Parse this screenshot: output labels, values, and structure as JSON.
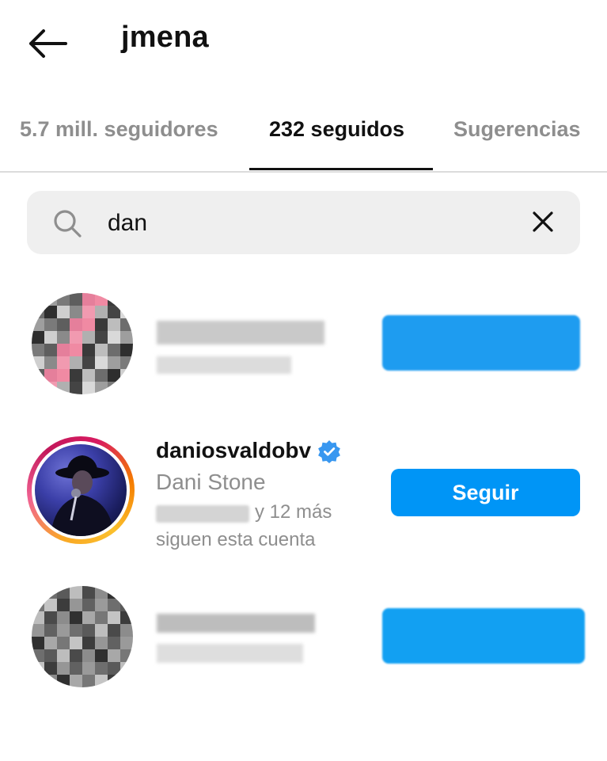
{
  "header": {
    "title": "jmena",
    "back_icon": "arrow-left-icon"
  },
  "tabs": [
    {
      "label": "5.7 mill. seguidores",
      "active": false
    },
    {
      "label": "232 seguidos",
      "active": true
    },
    {
      "label": "Sugerencias",
      "active": false
    }
  ],
  "search": {
    "value": "dan",
    "search_icon": "search-icon",
    "clear_icon": "close-icon"
  },
  "list": [
    {
      "username": "",
      "redacted": true
    },
    {
      "username": "daniosvaldobv",
      "verified": true,
      "full_name": "Dani Stone",
      "mutual_suffix": "y 12 más",
      "mutual_line2": "siguen esta cuenta",
      "action_label": "Seguir",
      "redacted": false
    },
    {
      "username": "",
      "redacted": true
    }
  ],
  "colors": {
    "accent": "#0095f6",
    "muted_text": "#8e8e8e",
    "verified": "#3897f0"
  }
}
